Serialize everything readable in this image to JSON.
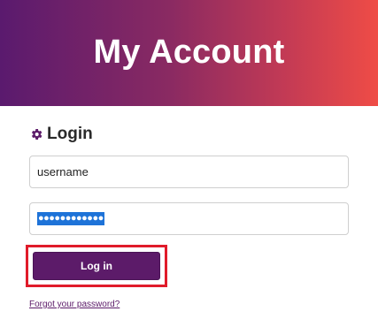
{
  "header": {
    "title": "My Account"
  },
  "login": {
    "heading": "Login",
    "heading_icon": "gear-icon",
    "username_value": "username",
    "password_masked": "●●●●●●●●●●●●",
    "submit_label": "Log in",
    "forgot_link": "Forgot your password?"
  },
  "colors": {
    "gradient_start": "#5a1a6e",
    "gradient_end": "#ef4c46",
    "button_bg": "#5c1b69",
    "highlight_frame": "#e01b2a",
    "selection": "#1e73d8"
  }
}
